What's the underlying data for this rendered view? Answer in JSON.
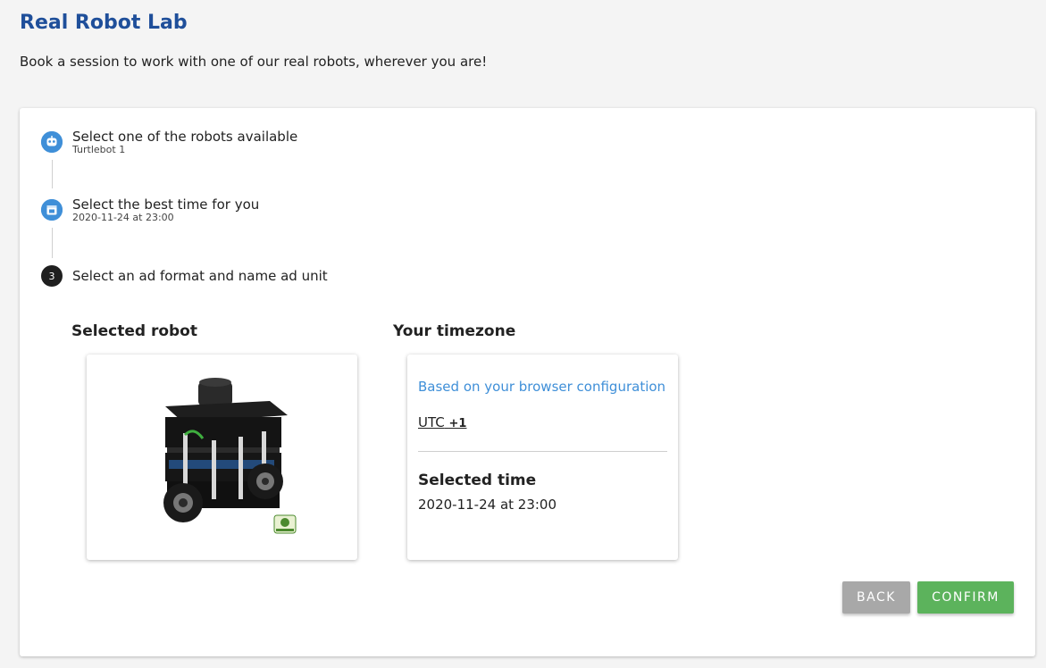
{
  "header": {
    "title": "Real Robot Lab",
    "subtitle": "Book a session to work with one of our real robots, wherever you are!"
  },
  "stepper": {
    "steps": [
      {
        "title": "Select one of the robots available",
        "subtitle": "Turtlebot 1",
        "icon": "robot-icon",
        "state": "done"
      },
      {
        "title": "Select the best time for you",
        "subtitle": "2020-11-24 at 23:00",
        "icon": "calendar-icon",
        "state": "done"
      },
      {
        "title": "Select an ad format and name ad unit",
        "number": "3",
        "state": "active"
      }
    ]
  },
  "robot_section": {
    "heading": "Selected robot",
    "image": "turtlebot-robot-image"
  },
  "timezone_section": {
    "heading": "Your timezone",
    "based_on": "Based on your browser configuration",
    "utc_label": "UTC",
    "utc_offset": "+1",
    "selected_time_label": "Selected time",
    "selected_time_value": "2020-11-24 at 23:00"
  },
  "actions": {
    "back_label": "BACK",
    "confirm_label": "CONFIRM"
  },
  "colors": {
    "title": "#1f4f9a",
    "accent_blue": "#3f8fd8",
    "confirm_green": "#5cb35c",
    "back_grey": "#a8a8a8"
  }
}
